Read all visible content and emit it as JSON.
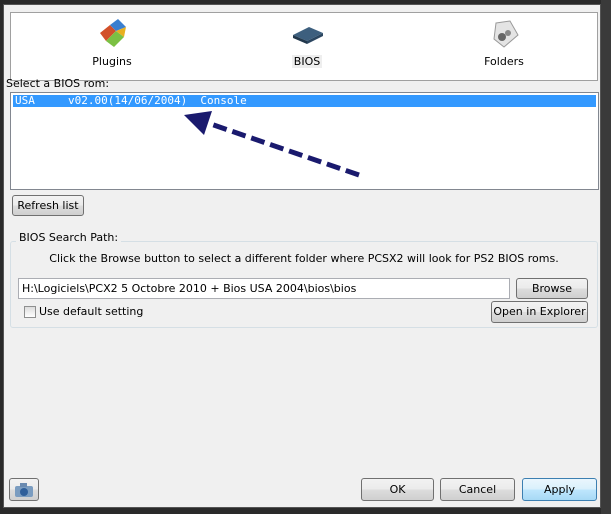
{
  "tabs": [
    {
      "label": "Plugins",
      "icon": "plugins-icon"
    },
    {
      "label": "BIOS",
      "icon": "chip-icon",
      "selected": true
    },
    {
      "label": "Folders",
      "icon": "folders-icon"
    }
  ],
  "bios_list": {
    "label": "Select a BIOS rom:",
    "items": [
      {
        "text": "USA     v02.00(14/06/2004)  Console",
        "selected": true
      }
    ]
  },
  "refresh_label": "Refresh list",
  "search_path": {
    "legend": "BIOS Search Path:",
    "hint": "Click the Browse button to select a different folder where PCSX2 will look for PS2 BIOS roms.",
    "value": "H:\\Logiciels\\PCX2 5 Octobre 2010 + Bios USA 2004\\bios\\bios",
    "browse_label": "Browse",
    "default_label": "Use default setting",
    "default_checked": false,
    "explorer_label": "Open in Explorer"
  },
  "footer": {
    "ok_label": "OK",
    "cancel_label": "Cancel",
    "apply_label": "Apply",
    "screenshot_icon": "camera-icon"
  },
  "colors": {
    "selection": "#3399ff",
    "arrow": "#1a1a6e"
  }
}
